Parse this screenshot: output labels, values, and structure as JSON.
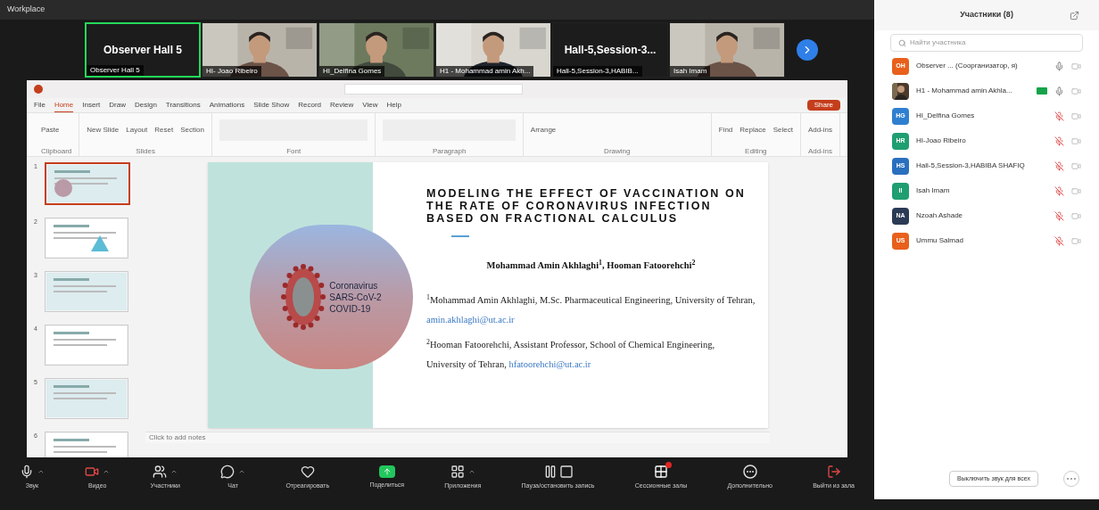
{
  "top_bar": {
    "title": "Workplace"
  },
  "video_strip": {
    "tiles": [
      {
        "kind": "name",
        "heading": "Observer Hall 5",
        "label": "Observer Hall 5",
        "selected": true
      },
      {
        "kind": "video",
        "label": "HI- Joao Ribeiro",
        "selected": false
      },
      {
        "kind": "video",
        "label": "HI_Delfina Gomes",
        "selected": false
      },
      {
        "kind": "video",
        "label": "H1 - Mohammad amin Akh...",
        "selected": false
      },
      {
        "kind": "name",
        "heading": "Hall-5,Session-3...",
        "label": "Hall-5,Session-3,HABIB...",
        "selected": false
      },
      {
        "kind": "video",
        "label": "Isah Imam",
        "selected": false
      }
    ]
  },
  "powerpoint": {
    "tabs": [
      {
        "label": "File",
        "selected": false
      },
      {
        "label": "Home",
        "selected": true
      },
      {
        "label": "Insert",
        "selected": false
      },
      {
        "label": "Draw",
        "selected": false
      },
      {
        "label": "Design",
        "selected": false
      },
      {
        "label": "Transitions",
        "selected": false
      },
      {
        "label": "Animations",
        "selected": false
      },
      {
        "label": "Slide Show",
        "selected": false
      },
      {
        "label": "Record",
        "selected": false
      },
      {
        "label": "Review",
        "selected": false
      },
      {
        "label": "View",
        "selected": false
      },
      {
        "label": "Help",
        "selected": false
      }
    ],
    "share_button": "Share",
    "ribbon_groups": [
      {
        "label": "Clipboard",
        "tools": [
          "Paste"
        ]
      },
      {
        "label": "Slides",
        "tools": [
          "New Slide",
          "Layout",
          "Reset",
          "Section"
        ]
      },
      {
        "label": "Font"
      },
      {
        "label": "Paragraph"
      },
      {
        "label": "Drawing",
        "tools": [
          "Arrange"
        ]
      },
      {
        "label": "Editing",
        "tools": [
          "Find",
          "Replace",
          "Select"
        ]
      },
      {
        "label": "Add-ins",
        "tools": [
          "Add-ins"
        ]
      }
    ],
    "thumbnails": [
      {
        "number": "1",
        "selected": true
      },
      {
        "number": "2",
        "selected": false
      },
      {
        "number": "3",
        "selected": false
      },
      {
        "number": "4",
        "selected": false
      },
      {
        "number": "5",
        "selected": false
      },
      {
        "number": "6",
        "selected": false
      }
    ],
    "slide": {
      "badge_lines": [
        "Coronavirus",
        "SARS-CoV-2",
        "COVID-19"
      ],
      "title": "MODELING THE EFFECT OF VACCINATION ON THE RATE OF CORONAVIRUS INFECTION BASED ON FRACTIONAL CALCULUS",
      "authors": "Mohammad Amin Akhlaghi$^{1}$, Hooman Fatoorehchi$^{2}$",
      "affiliations": [
        {
          "text": "$^{1}$Mohammad Amin Akhlaghi, M.Sc. Pharmaceutical Engineering, University of Tehran,",
          "email": "amin.akhlaghi@ut.ac.ir"
        },
        {
          "text": "$^{2}$Hooman Fatoorehchi, Assistant Professor, School of Chemical Engineering, University of Tehran,",
          "email": "hfatoorehchi@ut.ac.ir"
        }
      ]
    },
    "notes_placeholder": "Click to add notes"
  },
  "toolbar": [
    {
      "kind": "mic",
      "label": "Звук",
      "caret": true
    },
    {
      "kind": "video",
      "label": "Видео",
      "caret": true
    },
    {
      "kind": "people",
      "label": "Участники",
      "caret": true
    },
    {
      "kind": "chat",
      "label": "Чат",
      "caret": true
    },
    {
      "kind": "heart",
      "label": "Отреагировать",
      "caret": false
    },
    {
      "kind": "share",
      "label": "Поделиться",
      "caret": false
    },
    {
      "kind": "apps",
      "label": "Приложения",
      "caret": true
    },
    {
      "kind": "record",
      "label": "Пауза/остановить запись",
      "caret": false
    },
    {
      "kind": "rooms",
      "label": "Сессионные залы",
      "caret": false
    },
    {
      "kind": "more",
      "label": "Дополнительно",
      "caret": false
    },
    {
      "kind": "leave",
      "label": "Выйти из зала",
      "caret": false
    }
  ],
  "participants": {
    "title": "Участники (8)",
    "search": {
      "placeholder": "Найти участника"
    },
    "items": [
      {
        "kind": "initials",
        "initials": "OH",
        "color": "#e8601c",
        "name": "Observer ... (Соорганизатор, я)",
        "muted": false,
        "sharing": false
      },
      {
        "name": "H1 - Mohammad amin Akhla...",
        "muted": false,
        "sharing": true
      },
      {
        "kind": "initials",
        "initials": "HG",
        "color": "#2f7fd0",
        "name": "HI_Delfina Gomes",
        "muted": true,
        "sharing": false
      },
      {
        "kind": "initials",
        "initials": "HR",
        "color": "#1f9e72",
        "name": "HI-Joao Ribeiro",
        "muted": true,
        "sharing": false
      },
      {
        "kind": "initials",
        "initials": "HS",
        "color": "#2a6fbf",
        "name": "Hall-5,Session-3,HABIBA SHAFIQ",
        "muted": true,
        "sharing": false
      },
      {
        "kind": "initials",
        "initials": "II",
        "color": "#1f9e72",
        "name": "Isah Imam",
        "muted": true,
        "sharing": false
      },
      {
        "kind": "initials",
        "initials": "NA",
        "color": "#2b3a55",
        "name": "Nzoah Ashade",
        "muted": true,
        "sharing": false
      },
      {
        "kind": "initials",
        "initials": "US",
        "color": "#e8601c",
        "name": "Ummu Salmad",
        "muted": true,
        "sharing": false
      }
    ],
    "mute_all_button": "Выключить звук для всех"
  }
}
